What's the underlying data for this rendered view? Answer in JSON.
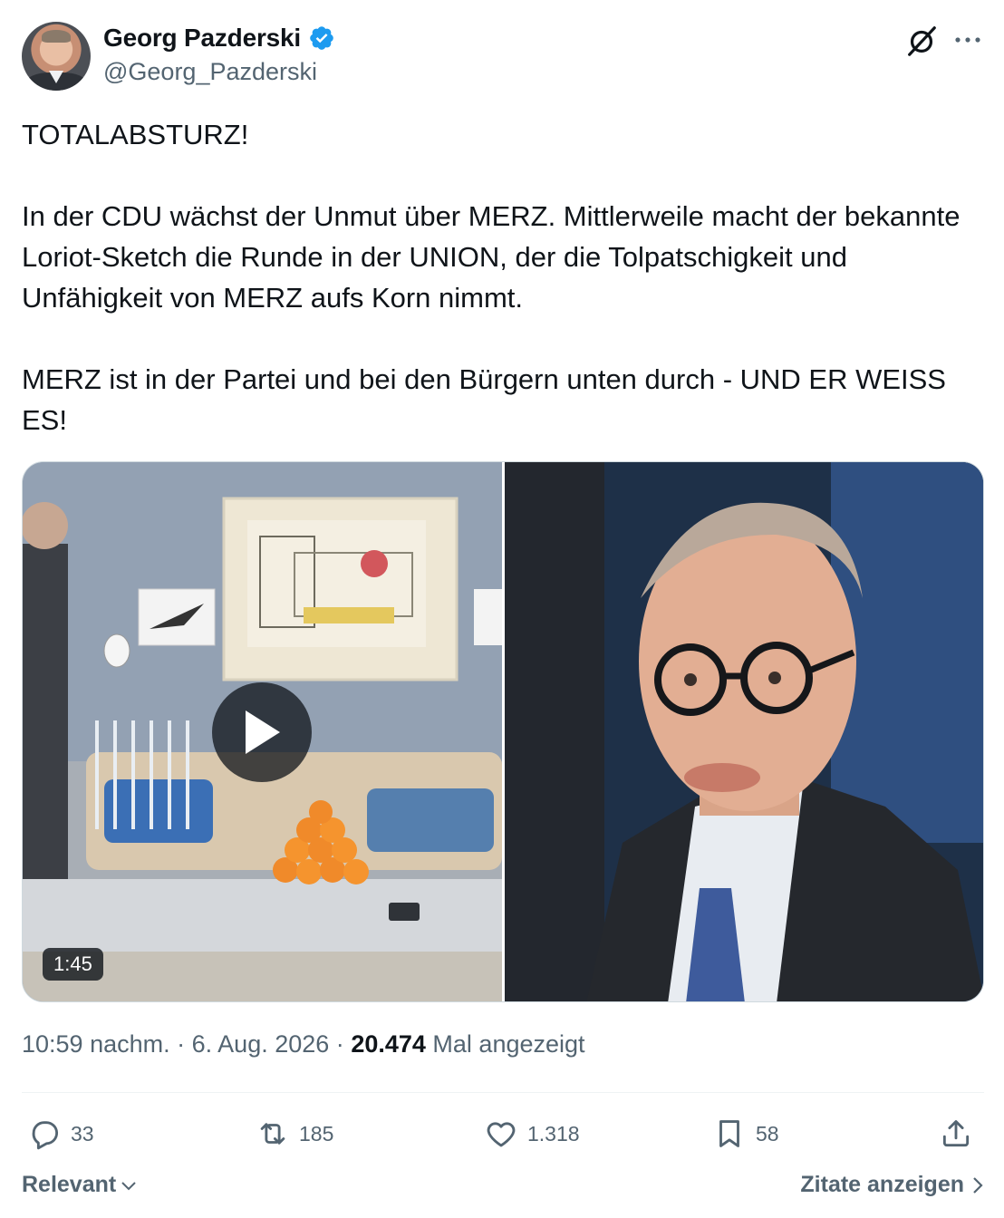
{
  "author": {
    "name": "Georg Pazderski",
    "handle": "@Georg_Pazderski",
    "verified_icon": "verified-badge-icon",
    "verified_color": "#1d9bf0"
  },
  "header_icons": [
    "grok-icon",
    "more-icon"
  ],
  "tweet": {
    "text": "TOTALABSTURZ!\n\nIn der CDU wächst der Unmut über MERZ. Mittlerweile macht der bekannte Loriot-Sketch die Runde in der UNION, der die Tolpatschigkeit und Unfähigkeit von MERZ aufs Korn nimmt.\n\nMERZ ist in der Partei und bei den Bürgern unten durch - UND ER WEISS ES!"
  },
  "media": {
    "video_duration": "1:45",
    "play_icon": "play-icon"
  },
  "meta": {
    "time": "10:59 nachm.",
    "separator": "·",
    "date": "6. Aug. 2026",
    "views_count": "20.474",
    "views_label": "Mal angezeigt"
  },
  "actions": {
    "replies": "33",
    "reposts": "185",
    "likes": "1.318",
    "bookmarks": "58"
  },
  "footer": {
    "sort_label": "Relevant",
    "quotes_label": "Zitate anzeigen"
  },
  "colors": {
    "text_primary": "#0f1419",
    "text_secondary": "#536471",
    "border": "#cfd9de",
    "accent": "#1d9bf0"
  }
}
